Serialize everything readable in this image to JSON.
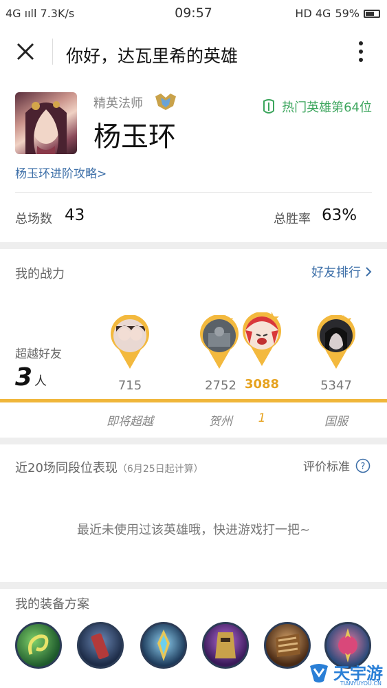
{
  "status_bar": {
    "network": "4G ııll  7.3K/s",
    "time": "09:57",
    "hd": "HD 4G",
    "battery": "59%"
  },
  "header": {
    "title": "你好，达瓦里希的英雄"
  },
  "hero": {
    "role": "精英法师",
    "name": "杨玉环",
    "rank_tag": "热门英雄第64位",
    "guide_link": "杨玉环进阶攻略>",
    "total_games_label": "总场数",
    "total_games": "43",
    "win_rate_label": "总胜率",
    "win_rate": "63%"
  },
  "power": {
    "section_title": "我的战力",
    "friend_rank_link": "好友排行",
    "surpass_label": "超越好友",
    "surpass_count": "3",
    "surpass_unit": "人",
    "markers": [
      {
        "score": "715",
        "label": "即将超越",
        "is_me": false
      },
      {
        "score": "2752",
        "label": "贺州",
        "is_me": false
      },
      {
        "score": "3088",
        "label": "1",
        "is_me": true
      },
      {
        "score": "5347",
        "label": "国服",
        "is_me": false
      }
    ]
  },
  "recent": {
    "title": "近20场同段位表现",
    "subtitle": "（6月25日起计算）",
    "criteria_link": "评价标准",
    "empty_message": "最近未使用过该英雄哦，快进游戏打一把~"
  },
  "equipment": {
    "title": "我的装备方案"
  },
  "watermark": {
    "text": "天宇游",
    "url": "TIANYUYOU.CN"
  },
  "colors": {
    "accent_orange": "#f0b63a",
    "link_blue": "#3d6fa8",
    "tag_green": "#3ba55c"
  }
}
